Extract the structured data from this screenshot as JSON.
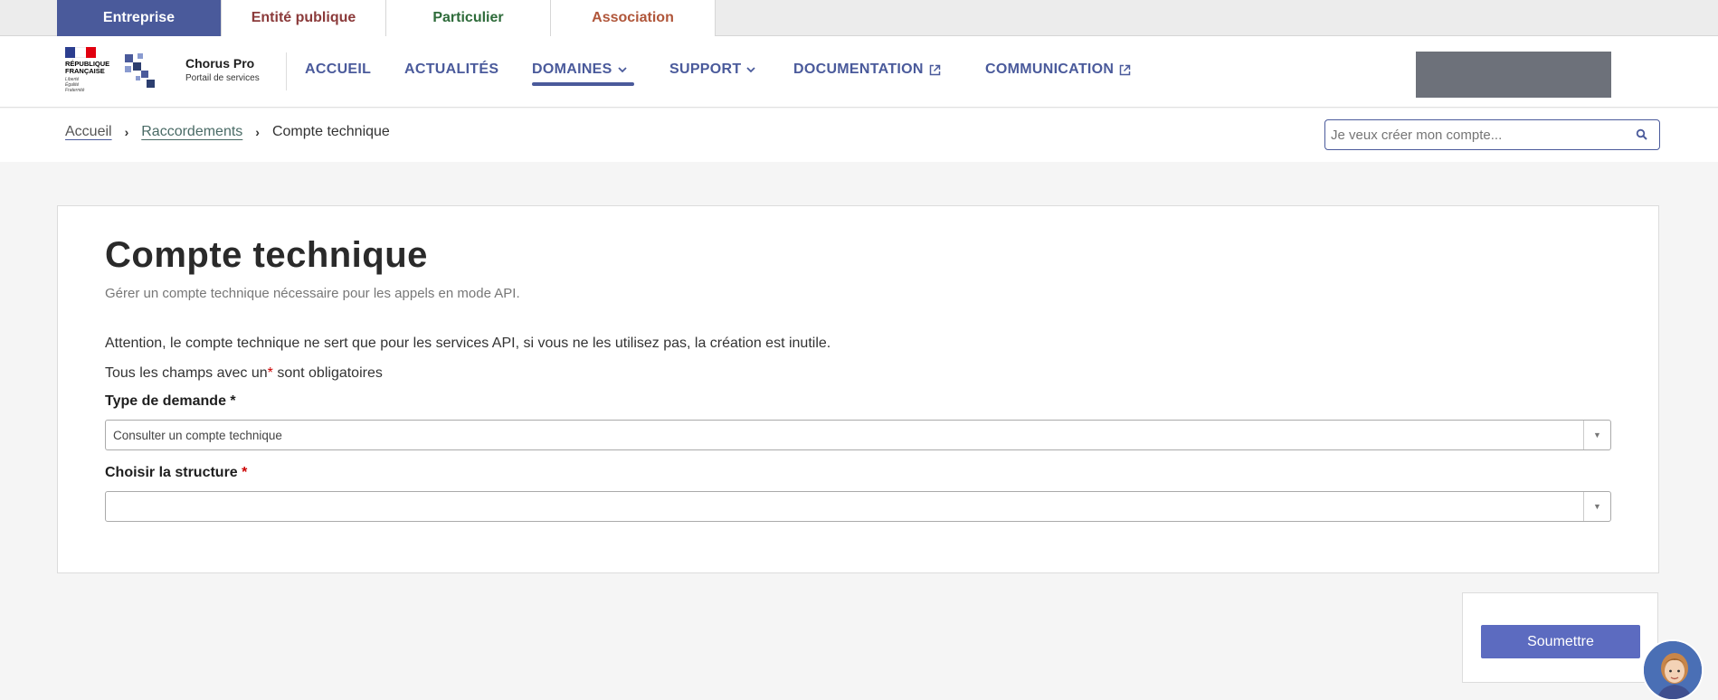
{
  "audience_tabs": [
    {
      "label": "Entreprise",
      "color": "#ffffff",
      "active": true
    },
    {
      "label": "Entité publique",
      "color": "#8b3a3a",
      "active": false
    },
    {
      "label": "Particulier",
      "color": "#2e6b3a",
      "active": false
    },
    {
      "label": "Association",
      "color": "#b0563a",
      "active": false
    }
  ],
  "header": {
    "gov_logo": {
      "line1": "RÉPUBLIQUE",
      "line2": "FRANÇAISE",
      "motto": [
        "Liberté",
        "Égalité",
        "Fraternité"
      ]
    },
    "brand_name": "Chorus Pro",
    "brand_subtitle": "Portail de services",
    "nav": [
      {
        "label": "ACCUEIL",
        "icon": null
      },
      {
        "label": "ACTUALITÉS",
        "icon": null
      },
      {
        "label": "DOMAINES",
        "icon": "chevron-down-icon",
        "active": true
      },
      {
        "label": "SUPPORT",
        "icon": "chevron-down-icon"
      },
      {
        "label": "DOCUMENTATION",
        "icon": "external-link-icon"
      },
      {
        "label": "COMMUNICATION",
        "icon": "external-link-icon"
      }
    ]
  },
  "breadcrumb": {
    "items": [
      "Accueil",
      "Raccordements"
    ],
    "current": "Compte technique"
  },
  "search": {
    "placeholder": "Je veux créer mon compte..."
  },
  "main": {
    "title": "Compte technique",
    "subtitle": "Gérer un compte technique nécessaire pour les appels en mode API.",
    "warning": "Attention, le compte technique ne sert que pour les services API, si vous ne les utilisez pas, la création est inutile.",
    "required_note_prefix": "Tous les champs avec un",
    "required_note_star": "*",
    "required_note_suffix": "sont obligatoires",
    "fields": [
      {
        "label": "Type de demande",
        "star": "*",
        "value": "Consulter un compte technique"
      },
      {
        "label": "Choisir la structure",
        "star": "*",
        "value": ""
      }
    ]
  },
  "actions": {
    "submit_label": "Soumettre"
  },
  "colors": {
    "primary": "#4a5a9b",
    "button": "#5c6bc0",
    "required": "#cc0000"
  }
}
